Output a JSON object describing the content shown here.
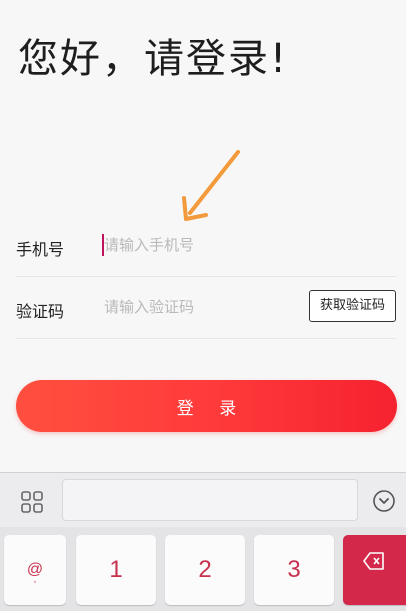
{
  "header": {
    "greeting": "您好，请登录!"
  },
  "form": {
    "phone": {
      "label": "手机号",
      "placeholder": "请输入手机号",
      "value": ""
    },
    "code": {
      "label": "验证码",
      "placeholder": "请输入验证码",
      "value": "",
      "get_code_label": "获取验证码"
    },
    "login_label": "登 录"
  },
  "keyboard": {
    "keys": [
      "@",
      "1",
      "2",
      "3"
    ],
    "at_sub": "·"
  },
  "colors": {
    "accent": "#ff3b3b",
    "key_text": "#c8304e",
    "annotation": "#f39a3c"
  }
}
